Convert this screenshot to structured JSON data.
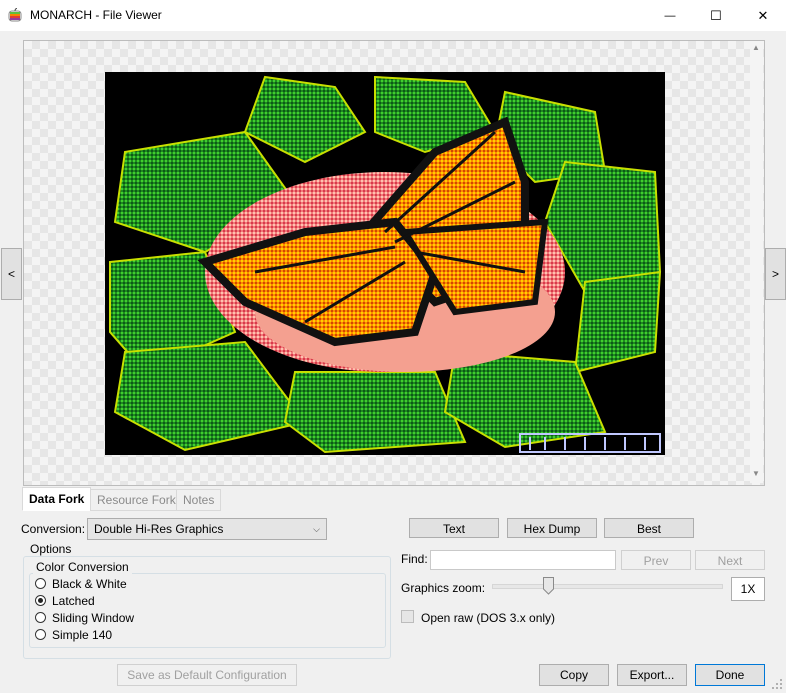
{
  "window": {
    "title": "MONARCH - File Viewer",
    "minimize_glyph": "—",
    "maximize_glyph": "☐",
    "close_glyph": "✕",
    "app_icon": "apple-icon"
  },
  "viewer": {
    "prev_label": "<",
    "next_label": ">",
    "image_description_icon": "monarch-butterfly-on-rose-image"
  },
  "tabs": [
    {
      "label": "Data Fork",
      "active": true
    },
    {
      "label": "Resource Fork",
      "active": false
    },
    {
      "label": "Notes",
      "active": false
    }
  ],
  "conversion": {
    "label": "Conversion:",
    "selected": "Double Hi-Res Graphics"
  },
  "options": {
    "legend": "Options",
    "color_conversion": {
      "legend": "Color Conversion",
      "choices": [
        {
          "label": "Black & White",
          "checked": false
        },
        {
          "label": "Latched",
          "checked": true
        },
        {
          "label": "Sliding Window",
          "checked": false
        },
        {
          "label": "Simple 140",
          "checked": false
        }
      ]
    }
  },
  "save_default_label": "Save as Default Configuration",
  "view_buttons": {
    "text": "Text",
    "hex": "Hex Dump",
    "best": "Best"
  },
  "find": {
    "label": "Find:",
    "value": "",
    "prev": "Prev",
    "next": "Next"
  },
  "zoom": {
    "label": "Graphics zoom:",
    "value": "1X",
    "slider_fraction": 0.25
  },
  "open_raw": {
    "label": "Open raw (DOS 3.x only)",
    "checked": false
  },
  "bottom_buttons": {
    "copy": "Copy",
    "export": "Export...",
    "done": "Done"
  },
  "colors": {
    "accent": "#0078d7",
    "button_face": "#e1e1e1",
    "window_bg": "#f0f0f0"
  }
}
